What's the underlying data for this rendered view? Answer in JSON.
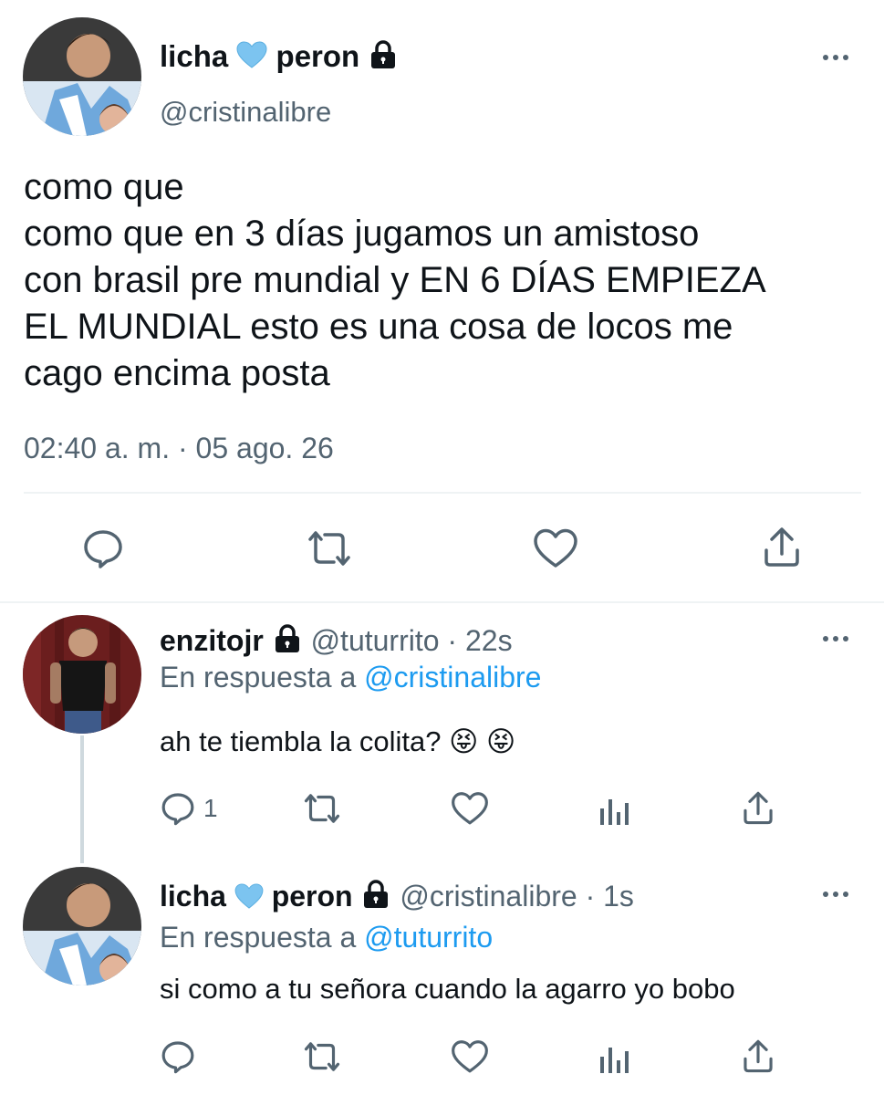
{
  "main_tweet": {
    "display_name_part1": "licha",
    "display_name_part2": "peron",
    "handle": "@cristinalibre",
    "text_lines": [
      "como que",
      "como que en 3 días jugamos un amistoso",
      "con brasil pre mundial y EN 6 DÍAS EMPIEZA",
      "EL MUNDIAL esto es una cosa de locos me",
      "cago encima posta"
    ],
    "timestamp": "02:40 a. m. · 05 ago. 26",
    "actions": [
      "reply-icon",
      "retweet-icon",
      "like-icon",
      "share-icon"
    ]
  },
  "reply1": {
    "display_name": "enzitojr",
    "handle": "@tuturrito",
    "separator": "·",
    "time": "22s",
    "reply_prefix": "En respuesta a",
    "reply_to": "@cristinalibre",
    "text": "ah te tiembla la colita?",
    "emoji": "😝",
    "reply_count": "1"
  },
  "reply2": {
    "display_name_part1": "licha",
    "display_name_part2": "peron",
    "handle": "@cristinalibre",
    "separator": "·",
    "time": "1s",
    "reply_prefix": "En respuesta a",
    "reply_to": "@tuturrito",
    "text": "si como a tu señora cuando la agarro yo bobo"
  },
  "colors": {
    "text": "#0f1419",
    "secondary": "#536471",
    "link": "#1d9bf0",
    "heart": "#7cc4f0",
    "divider": "#eff3f4"
  }
}
